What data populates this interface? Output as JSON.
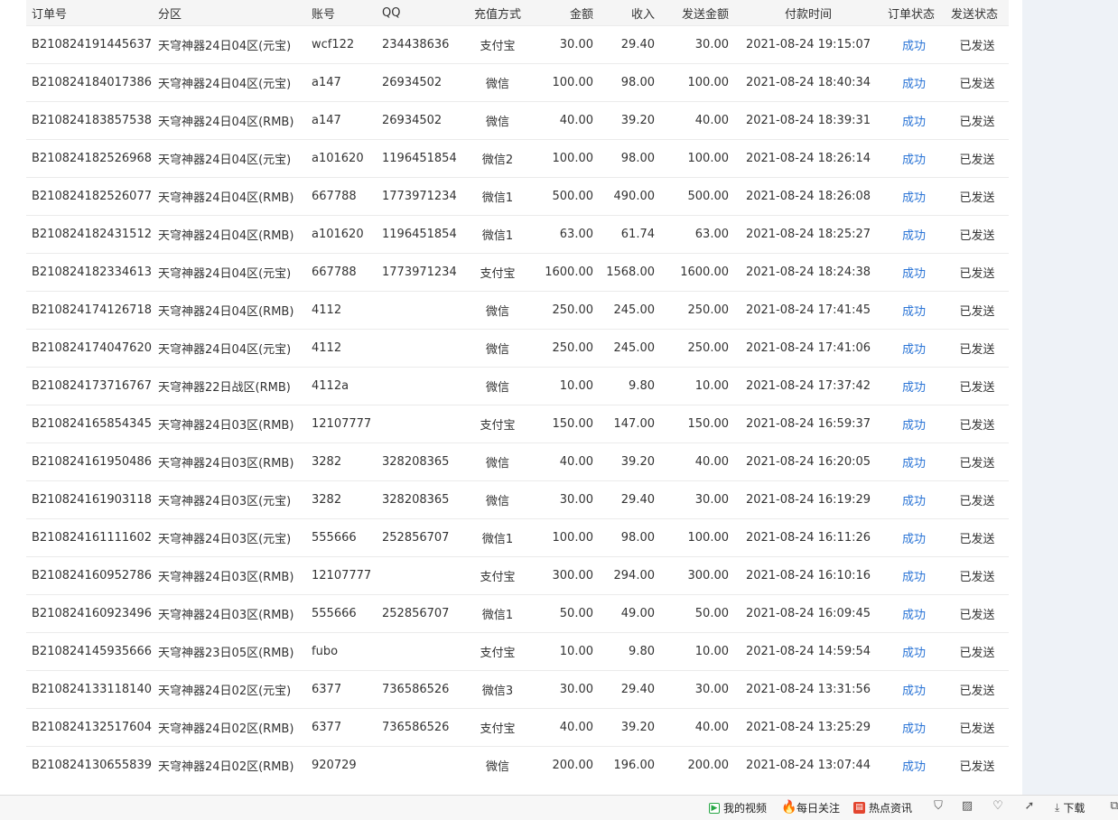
{
  "table": {
    "headers": [
      "订单号",
      "分区",
      "账号",
      "QQ",
      "充值方式",
      "金额",
      "收入",
      "发送金额",
      "付款时间",
      "订单状态",
      "发送状态"
    ],
    "rows": [
      [
        "B210824191445637",
        "天穹神器24日04区(元宝)",
        "wcf122",
        "234438636",
        "支付宝",
        "30.00",
        "29.40",
        "30.00",
        "2021-08-24 19:15:07",
        "成功",
        "已发送"
      ],
      [
        "B210824184017386",
        "天穹神器24日04区(元宝)",
        "a147",
        "26934502",
        "微信",
        "100.00",
        "98.00",
        "100.00",
        "2021-08-24 18:40:34",
        "成功",
        "已发送"
      ],
      [
        "B210824183857538",
        "天穹神器24日04区(RMB)",
        "a147",
        "26934502",
        "微信",
        "40.00",
        "39.20",
        "40.00",
        "2021-08-24 18:39:31",
        "成功",
        "已发送"
      ],
      [
        "B210824182526968",
        "天穹神器24日04区(元宝)",
        "a101620",
        "1196451854",
        "微信2",
        "100.00",
        "98.00",
        "100.00",
        "2021-08-24 18:26:14",
        "成功",
        "已发送"
      ],
      [
        "B210824182526077",
        "天穹神器24日04区(RMB)",
        "667788",
        "1773971234",
        "微信1",
        "500.00",
        "490.00",
        "500.00",
        "2021-08-24 18:26:08",
        "成功",
        "已发送"
      ],
      [
        "B210824182431512",
        "天穹神器24日04区(RMB)",
        "a101620",
        "1196451854",
        "微信1",
        "63.00",
        "61.74",
        "63.00",
        "2021-08-24 18:25:27",
        "成功",
        "已发送"
      ],
      [
        "B210824182334613",
        "天穹神器24日04区(元宝)",
        "667788",
        "1773971234",
        "支付宝",
        "1600.00",
        "1568.00",
        "1600.00",
        "2021-08-24 18:24:38",
        "成功",
        "已发送"
      ],
      [
        "B210824174126718",
        "天穹神器24日04区(RMB)",
        "4112",
        "",
        "微信",
        "250.00",
        "245.00",
        "250.00",
        "2021-08-24 17:41:45",
        "成功",
        "已发送"
      ],
      [
        "B210824174047620",
        "天穹神器24日04区(元宝)",
        "4112",
        "",
        "微信",
        "250.00",
        "245.00",
        "250.00",
        "2021-08-24 17:41:06",
        "成功",
        "已发送"
      ],
      [
        "B210824173716767",
        "天穹神器22日战区(RMB)",
        "4112a",
        "",
        "微信",
        "10.00",
        "9.80",
        "10.00",
        "2021-08-24 17:37:42",
        "成功",
        "已发送"
      ],
      [
        "B210824165854345",
        "天穹神器24日03区(RMB)",
        "12107777",
        "",
        "支付宝",
        "150.00",
        "147.00",
        "150.00",
        "2021-08-24 16:59:37",
        "成功",
        "已发送"
      ],
      [
        "B210824161950486",
        "天穹神器24日03区(RMB)",
        "3282",
        "328208365",
        "微信",
        "40.00",
        "39.20",
        "40.00",
        "2021-08-24 16:20:05",
        "成功",
        "已发送"
      ],
      [
        "B210824161903118",
        "天穹神器24日03区(元宝)",
        "3282",
        "328208365",
        "微信",
        "30.00",
        "29.40",
        "30.00",
        "2021-08-24 16:19:29",
        "成功",
        "已发送"
      ],
      [
        "B210824161111602",
        "天穹神器24日03区(元宝)",
        "555666",
        "252856707",
        "微信1",
        "100.00",
        "98.00",
        "100.00",
        "2021-08-24 16:11:26",
        "成功",
        "已发送"
      ],
      [
        "B210824160952786",
        "天穹神器24日03区(RMB)",
        "12107777",
        "",
        "支付宝",
        "300.00",
        "294.00",
        "300.00",
        "2021-08-24 16:10:16",
        "成功",
        "已发送"
      ],
      [
        "B210824160923496",
        "天穹神器24日03区(RMB)",
        "555666",
        "252856707",
        "微信1",
        "50.00",
        "49.00",
        "50.00",
        "2021-08-24 16:09:45",
        "成功",
        "已发送"
      ],
      [
        "B210824145935666",
        "天穹神器23日05区(RMB)",
        "fubo",
        "",
        "支付宝",
        "10.00",
        "9.80",
        "10.00",
        "2021-08-24 14:59:54",
        "成功",
        "已发送"
      ],
      [
        "B210824133118140",
        "天穹神器24日02区(元宝)",
        "6377",
        "736586526",
        "微信3",
        "30.00",
        "29.40",
        "30.00",
        "2021-08-24 13:31:56",
        "成功",
        "已发送"
      ],
      [
        "B210824132517604",
        "天穹神器24日02区(RMB)",
        "6377",
        "736586526",
        "支付宝",
        "40.00",
        "39.20",
        "40.00",
        "2021-08-24 13:25:29",
        "成功",
        "已发送"
      ],
      [
        "B210824130655839",
        "天穹神器24日02区(RMB)",
        "920729",
        "",
        "微信",
        "200.00",
        "196.00",
        "200.00",
        "2021-08-24 13:07:44",
        "成功",
        "已发送"
      ]
    ]
  },
  "statusbar": {
    "video_label": "我的视频",
    "daily_label": "每日关注",
    "news_label": "热点资讯",
    "download_label": "下载",
    "icons": [
      "shield-icon",
      "image-icon",
      "heart-icon",
      "rocket-icon",
      "download-icon",
      "copy-icon"
    ]
  },
  "colors": {
    "link": "#2a74d6",
    "header_bg": "#f5f5f5",
    "page_bg": "#eef2f7"
  }
}
